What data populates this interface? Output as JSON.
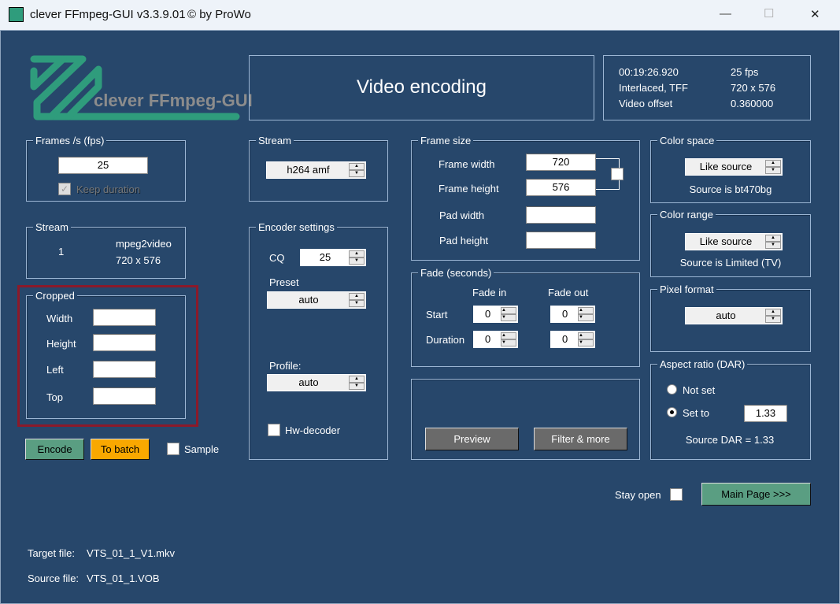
{
  "window": {
    "title": "clever FFmpeg-GUI v3.3.9.01",
    "copyright": "© by ProWo",
    "minimize": "—",
    "maximize": "☐",
    "close": "✕"
  },
  "logo": {
    "text": "clever FFmpeg-GUI"
  },
  "header": {
    "title": "Video encoding"
  },
  "info": {
    "duration": "00:19:26.920",
    "fps": "25 fps",
    "scan": "Interlaced, TFF",
    "size": "720 x 576",
    "offset_label": "Video offset",
    "offset_value": "0.360000"
  },
  "fps_group": {
    "label": "Frames /s (fps)",
    "value": "25",
    "keep_duration": "Keep duration"
  },
  "source_stream": {
    "label": "Stream",
    "index": "1",
    "codec": "mpeg2video",
    "size": "720 x 576"
  },
  "cropped": {
    "label": "Cropped",
    "width": "Width",
    "height": "Height",
    "left": "Left",
    "top": "Top",
    "width_value": "",
    "height_value": "",
    "left_value": "",
    "top_value": ""
  },
  "actions": {
    "encode": "Encode",
    "to_batch": "To batch",
    "sample": "Sample"
  },
  "stream": {
    "label": "Stream",
    "value": "h264  amf"
  },
  "encoder": {
    "label": "Encoder settings",
    "cq_label": "CQ",
    "cq_value": "25",
    "preset_label": "Preset",
    "preset_value": "auto",
    "profile_label": "Profile:",
    "profile_value": "auto",
    "hw_decoder": "Hw-decoder"
  },
  "frame_size": {
    "label": "Frame size",
    "frame_width": "Frame width",
    "frame_width_value": "720",
    "frame_height": "Frame height",
    "frame_height_value": "576",
    "pad_width": "Pad width",
    "pad_width_value": "",
    "pad_height": "Pad height",
    "pad_height_value": ""
  },
  "fade": {
    "label": "Fade (seconds)",
    "fade_in": "Fade in",
    "fade_out": "Fade out",
    "start": "Start",
    "duration": "Duration",
    "start_in": "0",
    "start_out": "0",
    "duration_in": "0",
    "duration_out": "0"
  },
  "preview": {
    "preview": "Preview",
    "filter": "Filter & more"
  },
  "color_space": {
    "label": "Color space",
    "value": "Like source",
    "source": "Source is bt470bg"
  },
  "color_range": {
    "label": "Color range",
    "value": "Like source",
    "source": "Source is Limited (TV)"
  },
  "pixel_format": {
    "label": "Pixel format",
    "value": "auto"
  },
  "aspect": {
    "label": "Aspect ratio (DAR)",
    "not_set": "Not set",
    "set_to": "Set to",
    "value": "1.33",
    "source": "Source DAR = 1.33"
  },
  "footer": {
    "stay_open": "Stay open",
    "main_page": "Main Page >>>",
    "target_label": "Target file:",
    "target_value": "VTS_01_1_V1.mkv",
    "source_label": "Source file:",
    "source_value": "VTS_01_1.VOB"
  },
  "colors": {
    "background": "#27476b",
    "green": "#5a9e82",
    "orange": "#f9a800",
    "highlight": "#8b1a2a"
  }
}
